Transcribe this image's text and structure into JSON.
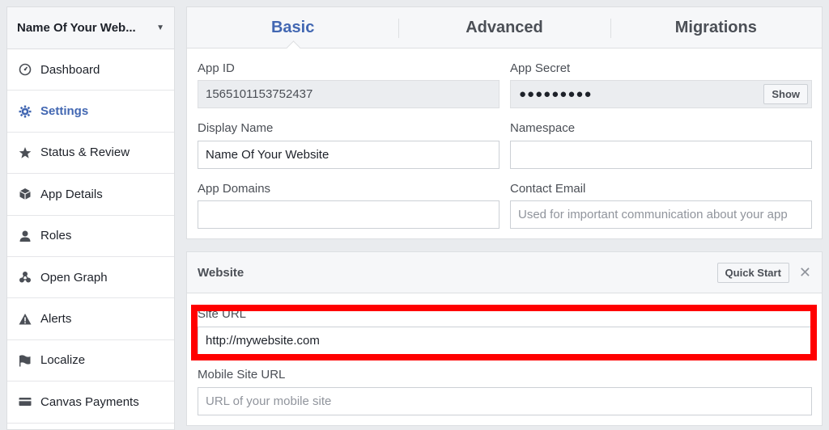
{
  "sidebar": {
    "app_name": "Name Of Your Web...",
    "items": [
      {
        "label": "Dashboard",
        "icon": "dashboard-icon"
      },
      {
        "label": "Settings",
        "icon": "gear-icon",
        "active": true
      },
      {
        "label": "Status & Review",
        "icon": "star-icon"
      },
      {
        "label": "App Details",
        "icon": "cube-icon"
      },
      {
        "label": "Roles",
        "icon": "person-icon"
      },
      {
        "label": "Open Graph",
        "icon": "graph-icon"
      },
      {
        "label": "Alerts",
        "icon": "warning-icon"
      },
      {
        "label": "Localize",
        "icon": "flag-icon"
      },
      {
        "label": "Canvas Payments",
        "icon": "card-icon"
      }
    ]
  },
  "tabs": [
    {
      "label": "Basic",
      "active": true
    },
    {
      "label": "Advanced"
    },
    {
      "label": "Migrations"
    }
  ],
  "basic": {
    "app_id_label": "App ID",
    "app_id_value": "1565101153752437",
    "app_secret_label": "App Secret",
    "app_secret_value": "●●●●●●●●●",
    "show_label": "Show",
    "display_name_label": "Display Name",
    "display_name_value": "Name Of Your Website",
    "namespace_label": "Namespace",
    "namespace_value": "",
    "app_domains_label": "App Domains",
    "app_domains_value": "",
    "contact_email_label": "Contact Email",
    "contact_email_placeholder": "Used for important communication about your app"
  },
  "website": {
    "title": "Website",
    "quick_start_label": "Quick Start",
    "close_label": "✕",
    "site_url_label": "Site URL",
    "site_url_value": "http://mywebsite.com",
    "mobile_site_url_label": "Mobile Site URL",
    "mobile_site_url_placeholder": "URL of your mobile site"
  },
  "colors": {
    "accent": "#4267b2",
    "highlight": "#ff0000"
  }
}
